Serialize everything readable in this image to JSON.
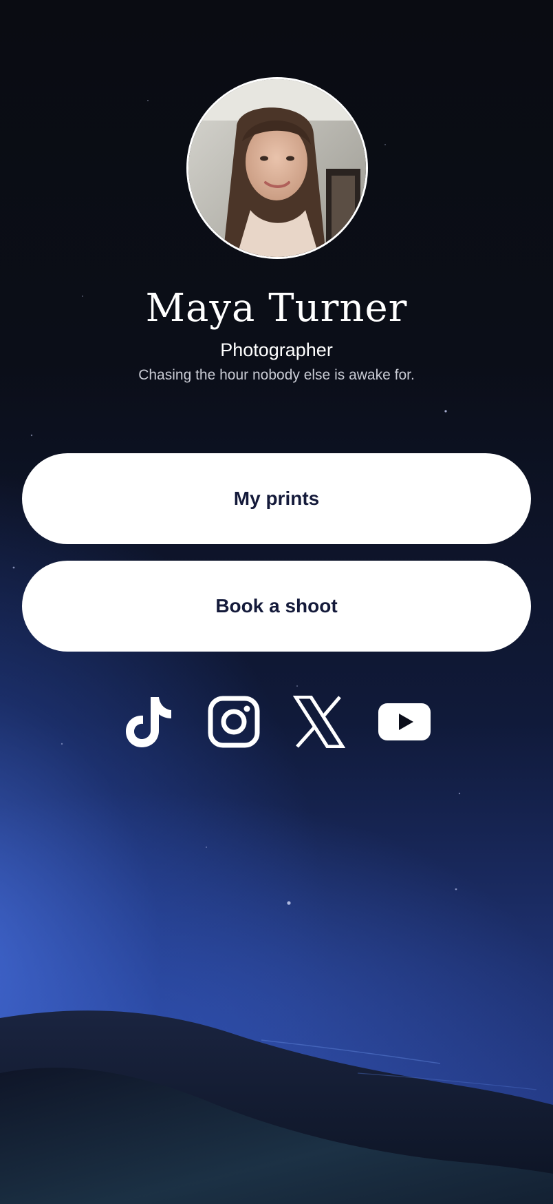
{
  "profile": {
    "name": "Maya Turner",
    "role": "Photographer",
    "bio": "Chasing the hour nobody else is awake for."
  },
  "links": [
    {
      "label": "My prints"
    },
    {
      "label": "Book a shoot"
    }
  ],
  "socials": [
    {
      "icon": "tiktok-icon"
    },
    {
      "icon": "instagram-icon"
    },
    {
      "icon": "x-icon"
    },
    {
      "icon": "youtube-icon"
    }
  ],
  "colors": {
    "button_bg": "#ffffff",
    "button_text": "#141a3a",
    "text_primary": "#ffffff",
    "text_secondary": "#c9cbd4",
    "sky_top": "#0a0c12",
    "sky_bottom": "#2a449a"
  }
}
